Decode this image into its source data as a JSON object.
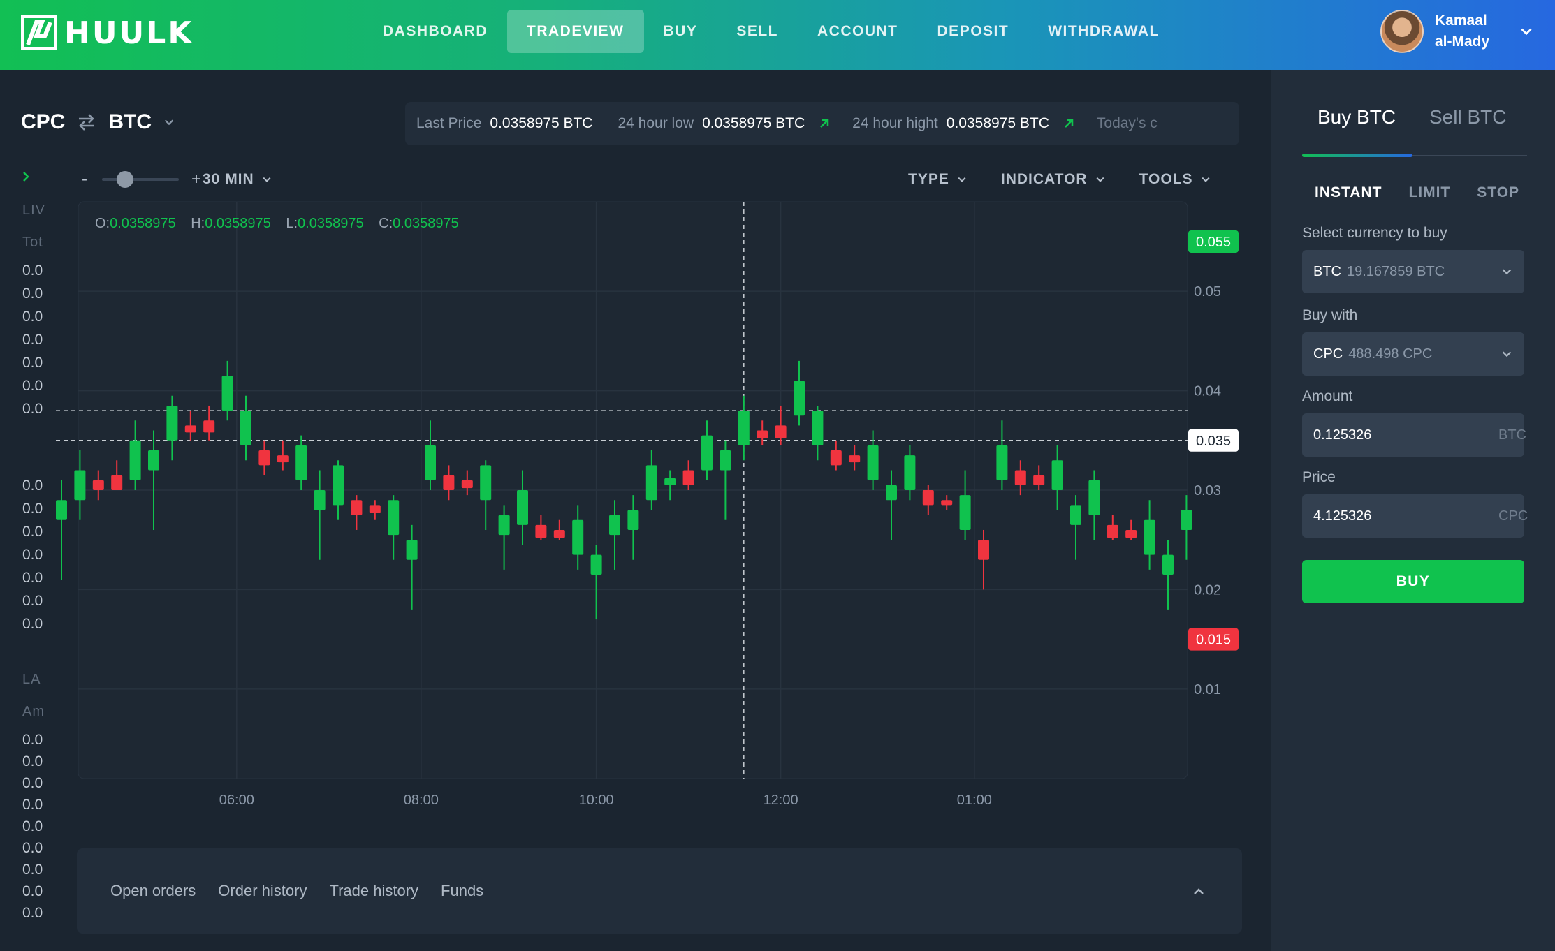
{
  "brand": {
    "name": "HUULK",
    "accent": "#10c24e",
    "sell_color": "#f0343f"
  },
  "nav": {
    "items": [
      "DASHBOARD",
      "TRADEVIEW",
      "BUY",
      "SELL",
      "ACCOUNT",
      "DEPOSIT",
      "WITHDRAWAL"
    ],
    "active": "TRADEVIEW"
  },
  "user": {
    "first_name": "Kamaal",
    "last_name": "al-Mady"
  },
  "pair": {
    "base": "CPC",
    "quote": "BTC"
  },
  "ticker": {
    "last_price_label": "Last Price",
    "last_price": "0.0358975 BTC",
    "low_label": "24 hour low",
    "low": "0.0358975 BTC",
    "high_label": "24 hour hight",
    "high": "0.0358975 BTC",
    "today_label": "Today's c"
  },
  "toolbar": {
    "minus": "-",
    "plus": "+",
    "interval": "30 MIN",
    "zoom_level": 0.3,
    "type": "TYPE",
    "indicator": "INDICATOR",
    "tools": "TOOLS"
  },
  "left_column": {
    "live_head": "LIV",
    "total_head": "Tot",
    "top_values": [
      "0.0",
      "0.0",
      "0.0",
      "0.0",
      "0.0",
      "0.0",
      "0.0"
    ],
    "mid_values": [
      "0.0",
      "0.0",
      "0.0",
      "0.0",
      "0.0",
      "0.0",
      "0.0"
    ],
    "last_head": "LA",
    "amount_head": "Am",
    "bottom_values": [
      "0.0",
      "0.0",
      "0.0",
      "0.0",
      "0.0",
      "0.0",
      "0.0",
      "0.0",
      "0.0"
    ]
  },
  "chart_data": {
    "type": "candlestick",
    "ohlc_legend": {
      "o_label": "O:",
      "o": "0.0358975",
      "h_label": "H:",
      "h": "0.0358975",
      "l_label": "L:",
      "l": "0.0358975",
      "c_label": "C:",
      "c": "0.0358975"
    },
    "y_ticks": [
      0.05,
      0.04,
      0.03,
      0.02,
      0.01
    ],
    "y_tick_labels": [
      "0.05",
      "0.04",
      "0.03",
      "0.02",
      "0.01"
    ],
    "ylim": [
      0.001,
      0.059
    ],
    "x_tick_labels": [
      "06:00",
      "08:00",
      "10:00",
      "12:00",
      "01:00"
    ],
    "x_tick_index": [
      9.5,
      19.5,
      29,
      39,
      49.5
    ],
    "price_tags": [
      {
        "value": 0.055,
        "label": "0.055",
        "color": "#10c24e"
      },
      {
        "value": 0.035,
        "label": "0.035",
        "color": "#ffffff"
      },
      {
        "value": 0.015,
        "label": "0.015",
        "color": "#f0343f"
      }
    ],
    "dashed_levels": [
      0.038,
      0.035
    ],
    "crosshair_index": 37,
    "candles": [
      {
        "o": 0.027,
        "h": 0.031,
        "l": 0.021,
        "c": 0.029
      },
      {
        "o": 0.029,
        "h": 0.034,
        "l": 0.027,
        "c": 0.032
      },
      {
        "o": 0.031,
        "h": 0.032,
        "l": 0.029,
        "c": 0.03
      },
      {
        "o": 0.0315,
        "h": 0.033,
        "l": 0.03,
        "c": 0.03
      },
      {
        "o": 0.031,
        "h": 0.037,
        "l": 0.03,
        "c": 0.035
      },
      {
        "o": 0.032,
        "h": 0.036,
        "l": 0.026,
        "c": 0.034
      },
      {
        "o": 0.035,
        "h": 0.0395,
        "l": 0.033,
        "c": 0.0385
      },
      {
        "o": 0.0365,
        "h": 0.038,
        "l": 0.035,
        "c": 0.0358
      },
      {
        "o": 0.037,
        "h": 0.0385,
        "l": 0.035,
        "c": 0.0358
      },
      {
        "o": 0.038,
        "h": 0.043,
        "l": 0.037,
        "c": 0.0415
      },
      {
        "o": 0.0345,
        "h": 0.0395,
        "l": 0.033,
        "c": 0.038
      },
      {
        "o": 0.034,
        "h": 0.035,
        "l": 0.0315,
        "c": 0.0325
      },
      {
        "o": 0.0335,
        "h": 0.035,
        "l": 0.032,
        "c": 0.0328
      },
      {
        "o": 0.031,
        "h": 0.0355,
        "l": 0.03,
        "c": 0.0345
      },
      {
        "o": 0.028,
        "h": 0.032,
        "l": 0.023,
        "c": 0.03
      },
      {
        "o": 0.0285,
        "h": 0.033,
        "l": 0.027,
        "c": 0.0325
      },
      {
        "o": 0.029,
        "h": 0.0295,
        "l": 0.026,
        "c": 0.0275
      },
      {
        "o": 0.0285,
        "h": 0.029,
        "l": 0.027,
        "c": 0.0277
      },
      {
        "o": 0.0255,
        "h": 0.0295,
        "l": 0.023,
        "c": 0.029
      },
      {
        "o": 0.023,
        "h": 0.0265,
        "l": 0.018,
        "c": 0.025
      },
      {
        "o": 0.031,
        "h": 0.037,
        "l": 0.03,
        "c": 0.0345
      },
      {
        "o": 0.0315,
        "h": 0.0325,
        "l": 0.029,
        "c": 0.03
      },
      {
        "o": 0.031,
        "h": 0.032,
        "l": 0.0295,
        "c": 0.0302
      },
      {
        "o": 0.029,
        "h": 0.033,
        "l": 0.026,
        "c": 0.0325
      },
      {
        "o": 0.0255,
        "h": 0.0285,
        "l": 0.022,
        "c": 0.0275
      },
      {
        "o": 0.0265,
        "h": 0.032,
        "l": 0.0245,
        "c": 0.03
      },
      {
        "o": 0.0265,
        "h": 0.0275,
        "l": 0.025,
        "c": 0.0252
      },
      {
        "o": 0.026,
        "h": 0.027,
        "l": 0.025,
        "c": 0.0252
      },
      {
        "o": 0.0235,
        "h": 0.0285,
        "l": 0.022,
        "c": 0.027
      },
      {
        "o": 0.0215,
        "h": 0.0245,
        "l": 0.017,
        "c": 0.0235
      },
      {
        "o": 0.0255,
        "h": 0.029,
        "l": 0.022,
        "c": 0.0275
      },
      {
        "o": 0.026,
        "h": 0.0295,
        "l": 0.023,
        "c": 0.028
      },
      {
        "o": 0.029,
        "h": 0.034,
        "l": 0.028,
        "c": 0.0325
      },
      {
        "o": 0.0305,
        "h": 0.032,
        "l": 0.029,
        "c": 0.0312
      },
      {
        "o": 0.032,
        "h": 0.033,
        "l": 0.03,
        "c": 0.0305
      },
      {
        "o": 0.032,
        "h": 0.037,
        "l": 0.031,
        "c": 0.0355
      },
      {
        "o": 0.032,
        "h": 0.035,
        "l": 0.027,
        "c": 0.034
      },
      {
        "o": 0.0345,
        "h": 0.0395,
        "l": 0.033,
        "c": 0.038
      },
      {
        "o": 0.036,
        "h": 0.037,
        "l": 0.0345,
        "c": 0.0352
      },
      {
        "o": 0.0365,
        "h": 0.0385,
        "l": 0.0345,
        "c": 0.0352
      },
      {
        "o": 0.0375,
        "h": 0.043,
        "l": 0.0365,
        "c": 0.041
      },
      {
        "o": 0.0345,
        "h": 0.0385,
        "l": 0.033,
        "c": 0.038
      },
      {
        "o": 0.034,
        "h": 0.035,
        "l": 0.032,
        "c": 0.0325
      },
      {
        "o": 0.0335,
        "h": 0.0345,
        "l": 0.032,
        "c": 0.0328
      },
      {
        "o": 0.031,
        "h": 0.036,
        "l": 0.03,
        "c": 0.0345
      },
      {
        "o": 0.029,
        "h": 0.032,
        "l": 0.025,
        "c": 0.0305
      },
      {
        "o": 0.03,
        "h": 0.0345,
        "l": 0.029,
        "c": 0.0335
      },
      {
        "o": 0.03,
        "h": 0.0305,
        "l": 0.0275,
        "c": 0.0285
      },
      {
        "o": 0.029,
        "h": 0.0295,
        "l": 0.028,
        "c": 0.0285
      },
      {
        "o": 0.026,
        "h": 0.032,
        "l": 0.025,
        "c": 0.0295
      },
      {
        "o": 0.025,
        "h": 0.026,
        "l": 0.02,
        "c": 0.023
      },
      {
        "o": 0.031,
        "h": 0.037,
        "l": 0.03,
        "c": 0.0345
      },
      {
        "o": 0.032,
        "h": 0.033,
        "l": 0.0295,
        "c": 0.0305
      },
      {
        "o": 0.0315,
        "h": 0.0325,
        "l": 0.03,
        "c": 0.0305
      },
      {
        "o": 0.03,
        "h": 0.0345,
        "l": 0.028,
        "c": 0.033
      },
      {
        "o": 0.0265,
        "h": 0.0295,
        "l": 0.023,
        "c": 0.0285
      },
      {
        "o": 0.0275,
        "h": 0.032,
        "l": 0.025,
        "c": 0.031
      },
      {
        "o": 0.0265,
        "h": 0.0275,
        "l": 0.025,
        "c": 0.0252
      },
      {
        "o": 0.026,
        "h": 0.027,
        "l": 0.025,
        "c": 0.0252
      },
      {
        "o": 0.0235,
        "h": 0.029,
        "l": 0.022,
        "c": 0.027
      },
      {
        "o": 0.0215,
        "h": 0.025,
        "l": 0.018,
        "c": 0.0235
      },
      {
        "o": 0.026,
        "h": 0.0295,
        "l": 0.023,
        "c": 0.028
      }
    ]
  },
  "bottom": {
    "tabs": [
      "Open orders",
      "Order history",
      "Trade history",
      "Funds"
    ]
  },
  "order": {
    "tabs": [
      "Buy BTC",
      "Sell BTC"
    ],
    "types": [
      "INSTANT",
      "LIMIT",
      "STOP"
    ],
    "select_label": "Select currency to buy",
    "select_currency": "BTC",
    "select_balance": "19.167859 BTC",
    "buy_with_label": "Buy with",
    "buy_with_currency": "CPC",
    "buy_with_balance": "488.498 CPC",
    "amount_label": "Amount",
    "amount_value": "0.125326",
    "amount_unit": "BTC",
    "price_label": "Price",
    "price_value": "4.125326",
    "price_unit": "CPC",
    "buy_button": "BUY"
  }
}
